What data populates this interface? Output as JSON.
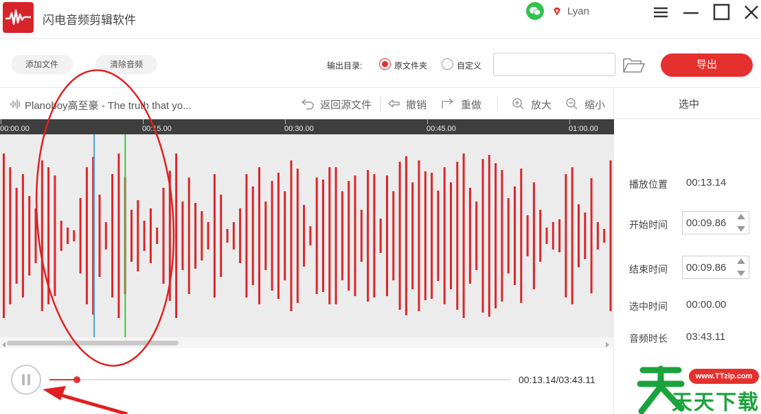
{
  "titlebar": {
    "app_title": "闪电音频剪辑软件",
    "username": "Lyan",
    "icons": [
      "app-logo-icon",
      "wechat-icon",
      "vip-diamond-icon",
      "menu-icon",
      "minimize-icon",
      "maximize-icon",
      "close-icon"
    ]
  },
  "toolbar": {
    "add_file": "添加文件",
    "clear_audio": "清除音频",
    "output_dir_label": "输出目录:",
    "radio_original": "原文件夹",
    "radio_custom": "自定义",
    "selected_output": "原文件夹",
    "path_value": "",
    "export": "导出"
  },
  "editor": {
    "file_name": "Planoboy高至豪 - The truth that yo...",
    "back_to_source": "返回源文件",
    "undo": "撤销",
    "redo": "重做",
    "zoom_in": "放大",
    "zoom_out": "缩小"
  },
  "timeline": {
    "ticks": [
      {
        "label": "00:00.00",
        "seconds": 0
      },
      {
        "label": "00:15.00",
        "seconds": 15
      },
      {
        "label": "00:30.00",
        "seconds": 30
      },
      {
        "label": "00:45.00",
        "seconds": 45
      },
      {
        "label": "01:00.00",
        "seconds": 60
      }
    ],
    "start_marker_seconds": 9.86,
    "playhead_seconds": 13.14,
    "scroll_fraction": 0.28
  },
  "panel": {
    "title": "选中",
    "play_position_label": "播放位置",
    "play_position": "00:13.14",
    "start_time_label": "开始时间",
    "start_time": "00:09.86",
    "end_time_label": "结束时间",
    "end_time": "00:09.86",
    "selected_time_label": "选中时间",
    "selected_time": "00:00.00",
    "duration_label": "音频时长",
    "duration": "03:43.11"
  },
  "player": {
    "time_readout": "00:13.14/03:43.11",
    "progress_fraction": 0.0588
  },
  "colors": {
    "accent": "#e4312e",
    "waveform": "#d9262b",
    "start_marker": "#4aa3e0",
    "playhead": "#3fc43f",
    "annotation": "#e02020"
  },
  "watermark": {
    "url": "www.TTzip.com",
    "text": "天天下载"
  }
}
